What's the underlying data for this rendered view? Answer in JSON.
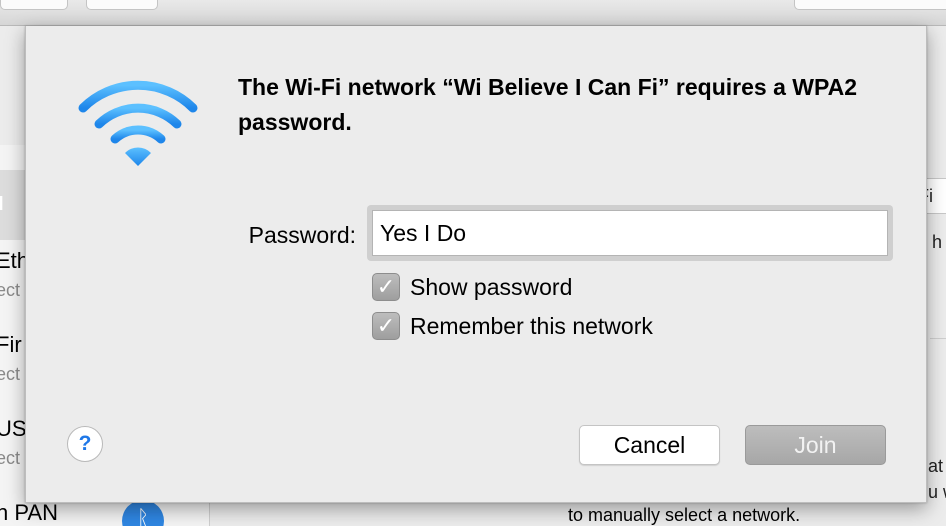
{
  "background": {
    "sidebar": {
      "header": "d",
      "items": [
        {
          "name": "Eth",
          "status": "ect"
        },
        {
          "name": "Fir",
          "status": "ect"
        },
        {
          "name": "US",
          "status": "ect"
        },
        {
          "name": "h PAN",
          "status": ""
        }
      ]
    },
    "right_fragments": {
      "search_text": "Fi",
      "line1": "h",
      "line2": "at",
      "line3": "u w"
    },
    "bottom_text": "to manually select a network."
  },
  "dialog": {
    "icon": "wifi-icon",
    "title": "The Wi-Fi network “Wi Believe I Can Fi” requires a WPA2 password.",
    "password_label": "Password:",
    "password_value": "Yes I Do",
    "checkboxes": [
      {
        "label": "Show password",
        "checked": true
      },
      {
        "label": "Remember this network",
        "checked": true
      }
    ],
    "help_symbol": "?",
    "cancel_label": "Cancel",
    "join_label": "Join",
    "colors": {
      "wifi_blue": "#2d9cf3",
      "help_blue": "#1f78e8",
      "join_disabled": "#a9a9a9"
    }
  }
}
